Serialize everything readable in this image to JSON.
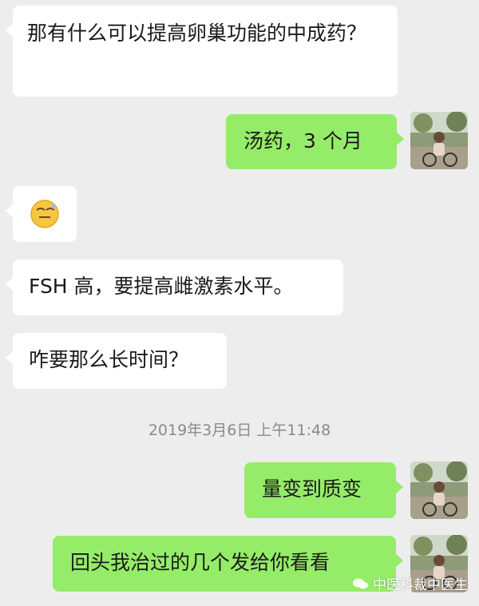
{
  "messages": [
    {
      "side": "left",
      "text": "那有什么可以提高卵巢功能的中成药？"
    },
    {
      "side": "right",
      "text": "汤药，3 个月"
    },
    {
      "side": "left",
      "emoji": "sweat-smile-emoji"
    },
    {
      "side": "left",
      "text": "FSH 高，要提高雌激素水平。"
    },
    {
      "side": "left",
      "text": "咋要那么长时间？"
    },
    {
      "side": "right",
      "text": "量变到质变"
    },
    {
      "side": "right",
      "text": "回头我治过的几个发给你看看"
    }
  ],
  "timestamp": "2019年3月6日 上午11:48",
  "watermark": "中医科裁中医生",
  "colors": {
    "background": "#ededed",
    "left_bubble": "#ffffff",
    "right_bubble": "#95ec69",
    "timestamp_text": "#8a8a8a"
  }
}
